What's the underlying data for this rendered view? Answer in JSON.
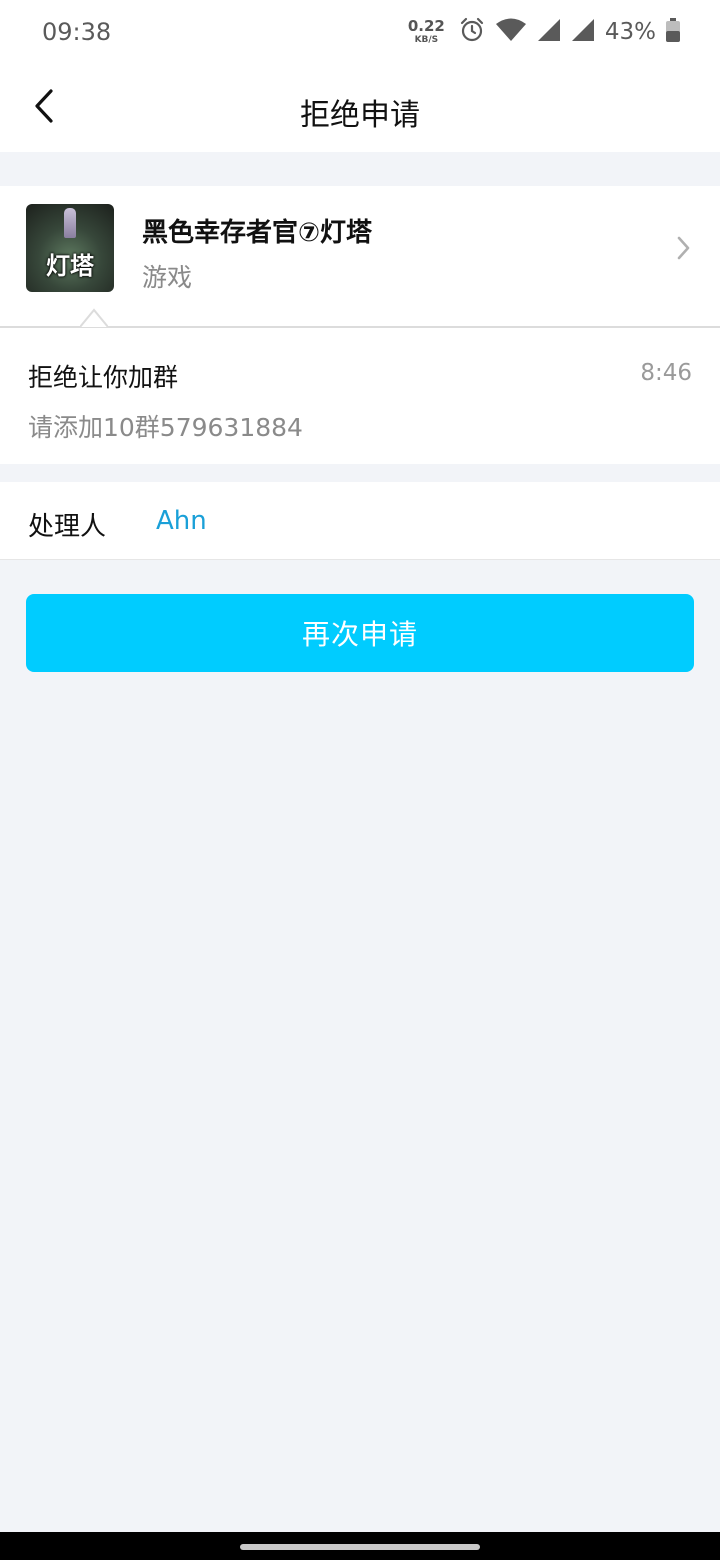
{
  "status_bar": {
    "time": "09:38",
    "net_speed_value": "0.22",
    "net_speed_unit": "KB/S",
    "battery_percent": "43%",
    "icons": [
      "alarm-icon",
      "wifi-icon",
      "signal-icon",
      "signal-icon",
      "battery-icon"
    ]
  },
  "nav": {
    "title": "拒绝申请",
    "back_icon": "chevron-left-icon"
  },
  "group": {
    "avatar_text": "灯塔",
    "name": "黑色幸存者官⑦灯塔",
    "category": "游戏",
    "chevron_icon": "chevron-right-icon"
  },
  "rejection": {
    "title": "拒绝让你加群",
    "time": "8:46",
    "message": "请添加10群579631884"
  },
  "handler": {
    "label": "处理人",
    "name": "Ahn"
  },
  "actions": {
    "reapply_label": "再次申请"
  },
  "colors": {
    "accent": "#00ccff",
    "link": "#1aa0d8",
    "background": "#f2f4f8"
  }
}
